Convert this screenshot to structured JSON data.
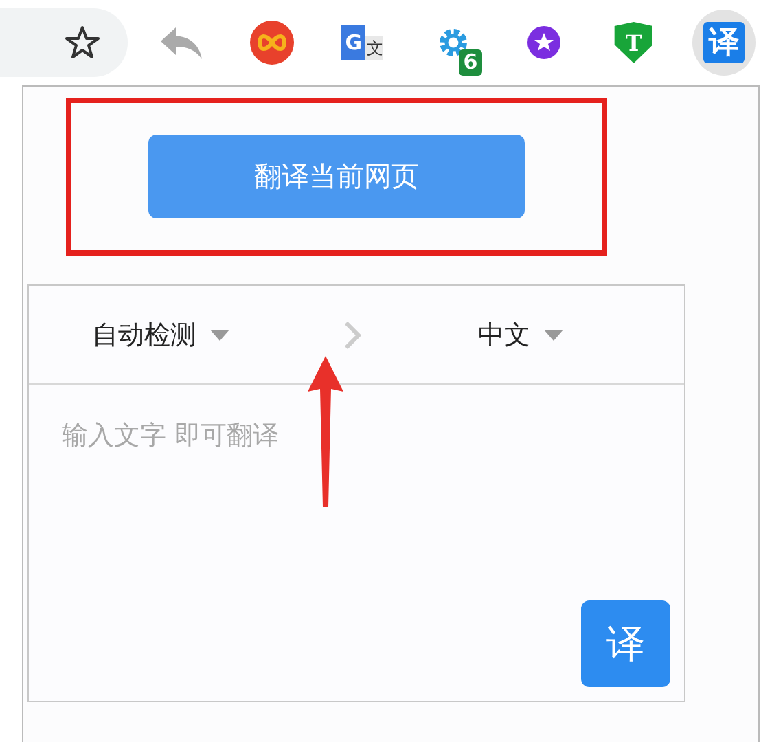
{
  "toolbar": {
    "extensions": [
      {
        "kind": "reply",
        "active": false
      },
      {
        "kind": "infinity",
        "active": false
      },
      {
        "kind": "gtranslate",
        "glyphs": [
          "G",
          "文"
        ],
        "active": false
      },
      {
        "kind": "gear",
        "badge": "6",
        "active": false
      },
      {
        "kind": "star",
        "active": false
      },
      {
        "kind": "shield",
        "glyphs": [
          "T"
        ],
        "active": false
      },
      {
        "kind": "translator",
        "glyphs": [
          "译"
        ],
        "active": true
      }
    ]
  },
  "popup": {
    "translate_page_button": "翻译当前网页",
    "source_language": "自动检测",
    "target_language": "中文",
    "input": {
      "placeholder": "输入文字 即可翻译"
    },
    "translate_button": "译"
  }
}
